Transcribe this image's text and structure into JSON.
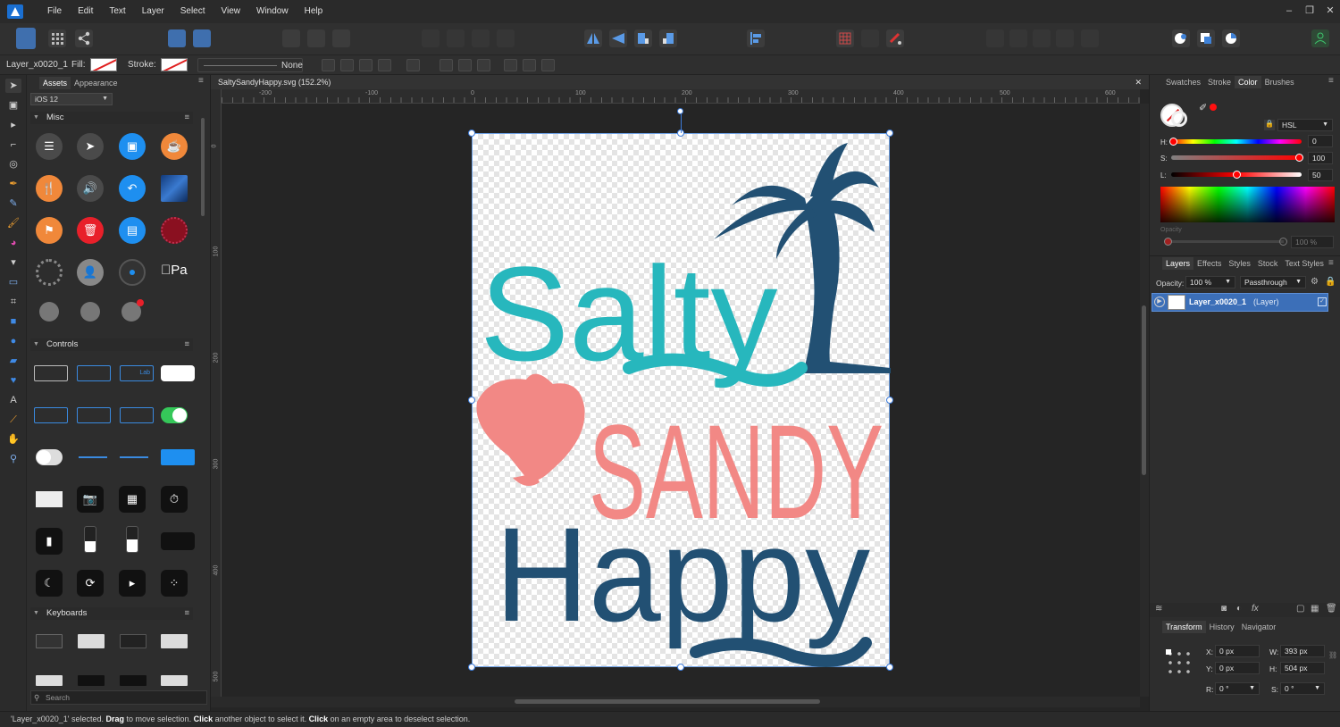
{
  "menu": [
    "File",
    "Edit",
    "Text",
    "Layer",
    "Select",
    "View",
    "Window",
    "Help"
  ],
  "context": {
    "layer_name": "Layer_x0020_1",
    "fill_label": "Fill:",
    "stroke_label": "Stroke:",
    "stroke_value": "None"
  },
  "assets": {
    "tabs": [
      "Assets",
      "Appearance"
    ],
    "category": "iOS 12",
    "groups": {
      "misc": "Misc",
      "controls": "Controls",
      "keyboards": "Keyboards"
    },
    "ctrl_label": "Lab",
    "apple_pay": "Pa",
    "search_placeholder": "Search"
  },
  "document": {
    "tab_title": "SaltySandyHappy.svg (152.2%)",
    "ruler_h": [
      "-200",
      "-100",
      "0",
      "100",
      "200",
      "300",
      "400",
      "500",
      "600"
    ],
    "ruler_v": [
      "0",
      "100",
      "200",
      "300",
      "400",
      "500"
    ],
    "art_text": {
      "line1": "Salty",
      "line2": "SANDY",
      "line3": "Happy"
    },
    "art_colors": {
      "teal": "#27b7bd",
      "coral": "#f28885",
      "navy": "#225073"
    }
  },
  "color_panel": {
    "tabs": [
      "Swatches",
      "Stroke",
      "Color",
      "Brushes"
    ],
    "mode": "HSL",
    "h_label": "H:",
    "s_label": "S:",
    "l_label": "L:",
    "h": "0",
    "s": "100",
    "l": "50",
    "opacity_label": "Opacity",
    "opacity": "100 %"
  },
  "layers_panel": {
    "tabs": [
      "Layers",
      "Effects",
      "Styles",
      "Stock",
      "Text Styles"
    ],
    "opacity_label": "Opacity:",
    "opacity": "100 %",
    "blend": "Passthrough",
    "layer_label": "Layer_x0020_1",
    "layer_type": "(Layer)"
  },
  "transform_panel": {
    "tabs": [
      "Transform",
      "History",
      "Navigator"
    ],
    "x_label": "X:",
    "y_label": "Y:",
    "w_label": "W:",
    "h_label": "H:",
    "r_label": "R:",
    "s_label": "S:",
    "x": "0 px",
    "y": "0 px",
    "w": "393 px",
    "h": "504 px",
    "r": "0 °",
    "s": "0 °"
  },
  "status": {
    "part1": "'Layer_x0020_1' selected. ",
    "drag": "Drag",
    "part2": " to move selection. ",
    "click": "Click",
    "part3": " another object to select it. ",
    "click2": "Click",
    "part4": " on an empty area to deselect selection."
  }
}
